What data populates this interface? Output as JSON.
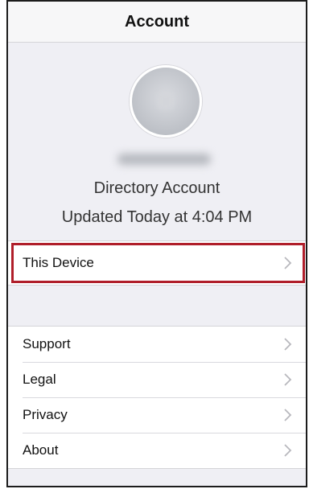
{
  "navbar": {
    "title": "Account"
  },
  "profile": {
    "account_type": "Directory Account",
    "updated": "Updated Today at 4:04 PM"
  },
  "device_row": {
    "label": "This Device"
  },
  "menu": {
    "items": [
      {
        "label": "Support"
      },
      {
        "label": "Legal"
      },
      {
        "label": "Privacy"
      },
      {
        "label": "About"
      }
    ]
  },
  "colors": {
    "highlight": "#b01e2a",
    "background": "#efeff4"
  }
}
